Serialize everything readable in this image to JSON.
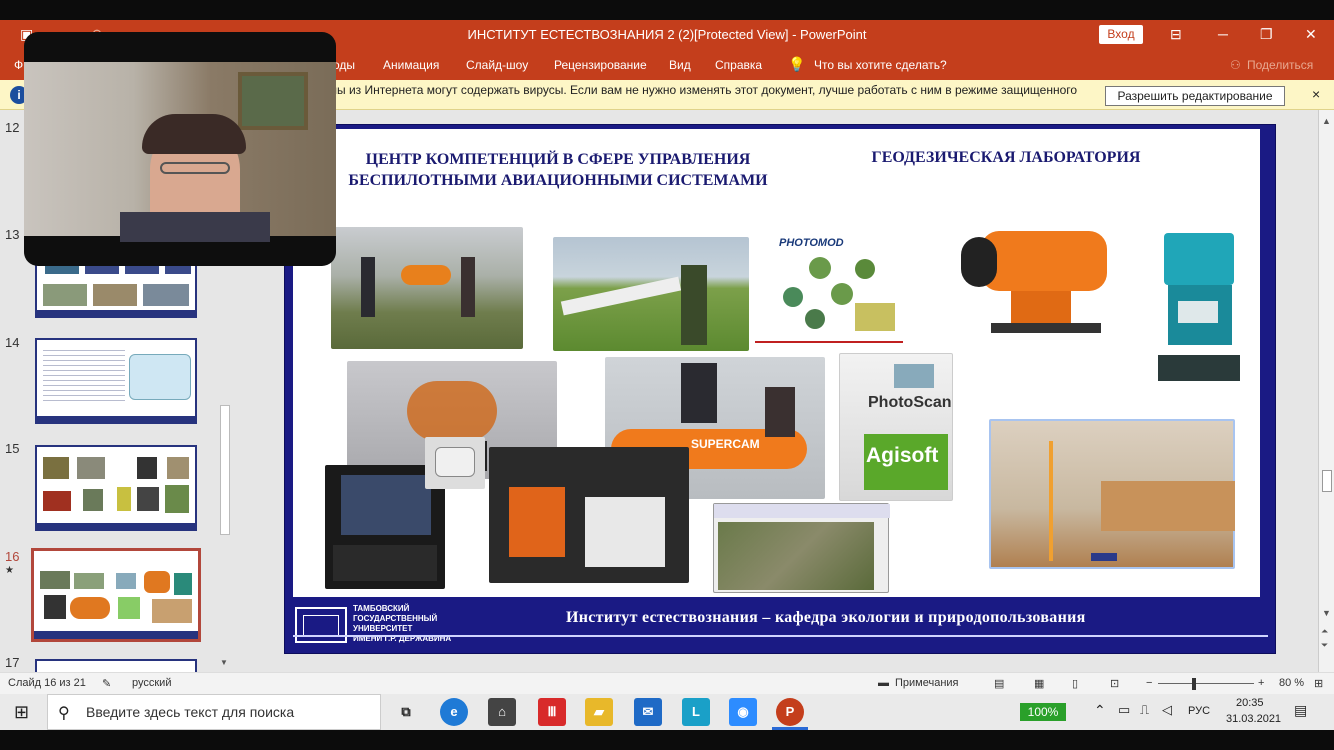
{
  "window": {
    "title": "ИНСТИТУТ ЕСТЕСТВОЗНАНИЯ 2 (2)[Protected View]  -  PowerPoint",
    "login_label": "Вход",
    "file_tab": "Ф",
    "menu_items": [
      "оды",
      "Анимация",
      "Слайд-шоу",
      "Рецензирование",
      "Вид",
      "Справка",
      "Что вы хотите сделать?"
    ],
    "share_label": "Поделиться"
  },
  "infobar": {
    "message": "лы из Интернета могут содержать вирусы. Если вам не нужно изменять этот документ, лучше работать с ним в режиме защищенного",
    "enable_label": "Разрешить редактирование",
    "close_glyph": "×"
  },
  "thumbnails": [
    {
      "number": "12"
    },
    {
      "number": "13"
    },
    {
      "number": "14"
    },
    {
      "number": "15"
    },
    {
      "number": "16",
      "star": "★"
    },
    {
      "number": "17"
    }
  ],
  "slide": {
    "heading_left": "ЦЕНТР КОМПЕТЕНЦИЙ В СФЕРЕ УПРАВЛЕНИЯ БЕСПИЛОТНЫМИ АВИАЦИОННЫМИ СИСТЕМАМИ",
    "heading_right": "ГЕОДЕЗИЧЕСКАЯ ЛАБОРАТОРИЯ",
    "logo_text_1": "ТАМБОВСКИЙ",
    "logo_text_2": "ГОСУДАРСТВЕННЫЙ",
    "logo_text_3": "УНИВЕРСИТЕТ",
    "logo_text_4": "ИМЕНИ Г.Р. ДЕРЖАВИНА",
    "footer": "Институт естествознания – кафедра экологии и природопользования",
    "photomod": "PHOTOMOD",
    "photoscan": "PhotoScan",
    "agisoft": "Agisoft",
    "supercam": "SUPERCAM"
  },
  "statusbar": {
    "slide_info": "Слайд 16 из 21",
    "language": "русский",
    "notes": "Примечания",
    "zoom": "80 %",
    "zoom_minus": "−",
    "zoom_plus": "+"
  },
  "taskbar": {
    "search_placeholder": "Введите здесь текст для поиска",
    "battery": "100%",
    "lang": "РУС",
    "time": "20:35",
    "date": "31.03.2021"
  }
}
